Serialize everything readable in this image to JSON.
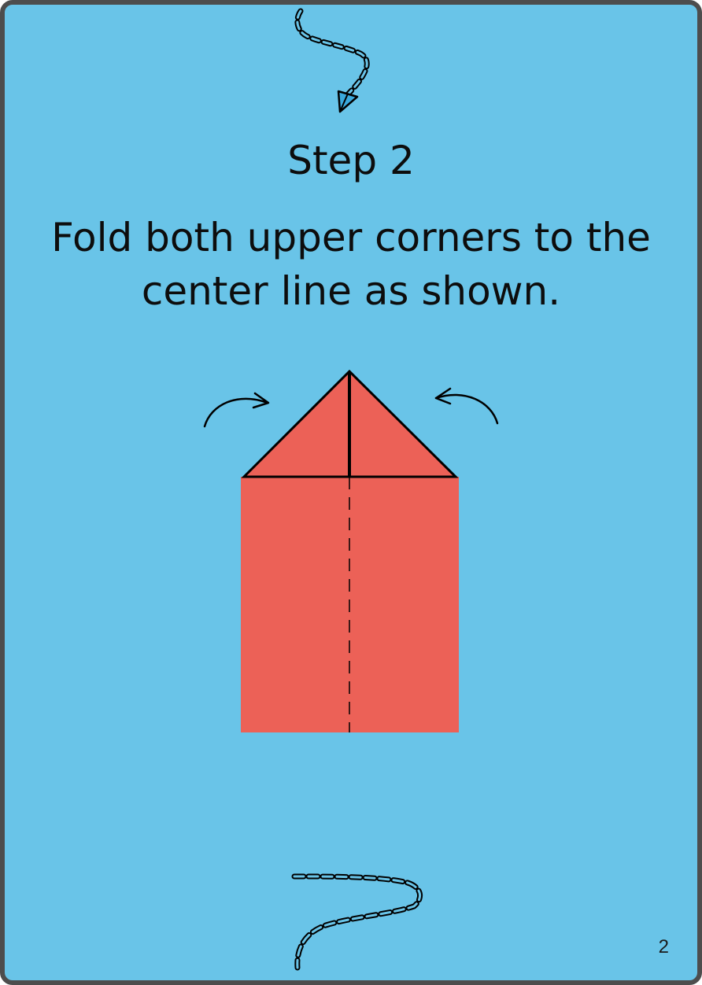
{
  "step": {
    "title": "Step 2",
    "instruction_line1": "Fold both upper corners to the",
    "instruction_line2": "center line as shown."
  },
  "page": {
    "number": "2"
  },
  "colors": {
    "background": "#69c4e8",
    "border": "#4d4d4d",
    "paper": "#ec6157",
    "line": "#000000",
    "plane_tip": "#3aa9dc"
  },
  "icons": {
    "top": "dashed-flight-path-with-paper-plane-icon",
    "bottom": "dashed-flight-path-icon",
    "left_arrow": "curved-arrow-right-icon",
    "right_arrow": "curved-arrow-left-icon"
  }
}
